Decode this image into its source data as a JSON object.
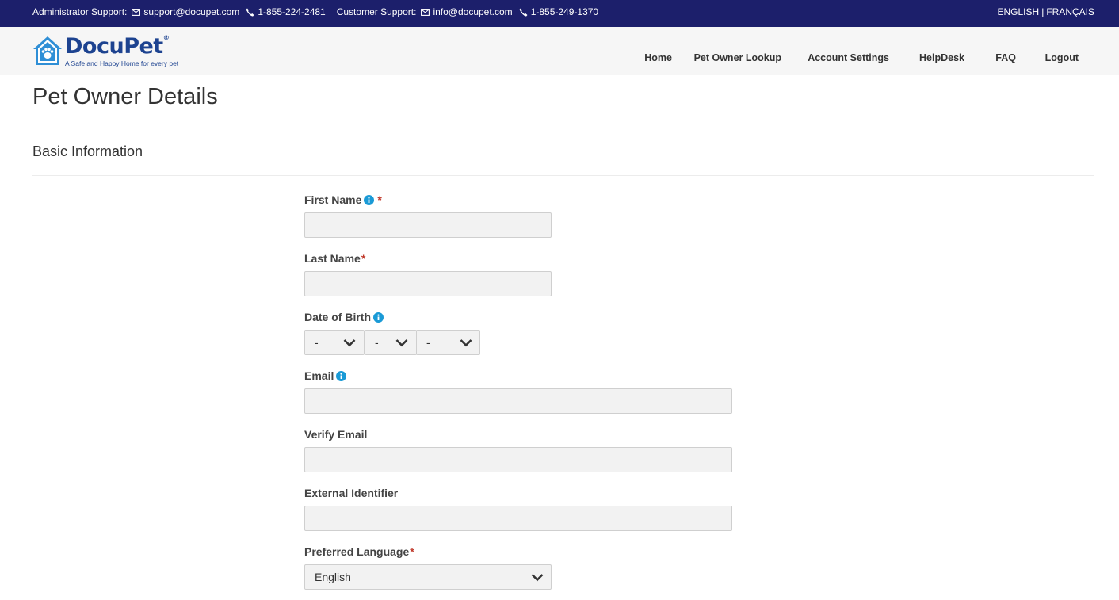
{
  "topbar": {
    "admin_label": "Administrator Support:",
    "admin_email": "support@docupet.com",
    "admin_phone": "1-855-224-2481",
    "customer_label": "Customer Support:",
    "customer_email": "info@docupet.com",
    "customer_phone": "1-855-249-1370",
    "lang_english": "ENGLISH",
    "lang_sep": "|",
    "lang_french": "FRANÇAIS",
    "icons": [
      "envelope-icon",
      "phone-icon"
    ]
  },
  "header": {
    "logo_text": "DocuPet",
    "logo_tagline": "A Safe and Happy Home for every pet",
    "logo_mark": "®",
    "nav": [
      "Home",
      "Pet Owner Lookup",
      "Account Settings",
      "HelpDesk",
      "FAQ",
      "Logout"
    ]
  },
  "page": {
    "title": "Pet Owner Details",
    "section": "Basic Information"
  },
  "form": {
    "first_name_label": "First Name",
    "last_name_label": "Last Name",
    "dob_label": "Date of Birth",
    "dob_day": "-",
    "dob_month": "-",
    "dob_year": "-",
    "email_label": "Email",
    "verify_email_label": "Verify Email",
    "external_id_label": "External Identifier",
    "language_label": "Preferred Language",
    "language_value": "English",
    "required_mark": "*"
  },
  "colors": {
    "topbar_bg": "#1c1f6b",
    "brand_blue": "#1d4390",
    "logo_light_blue": "#2f8fd6",
    "info_icon": "#1a9ad6",
    "required": "#c0392b",
    "field_bg": "#f2f2f2"
  }
}
